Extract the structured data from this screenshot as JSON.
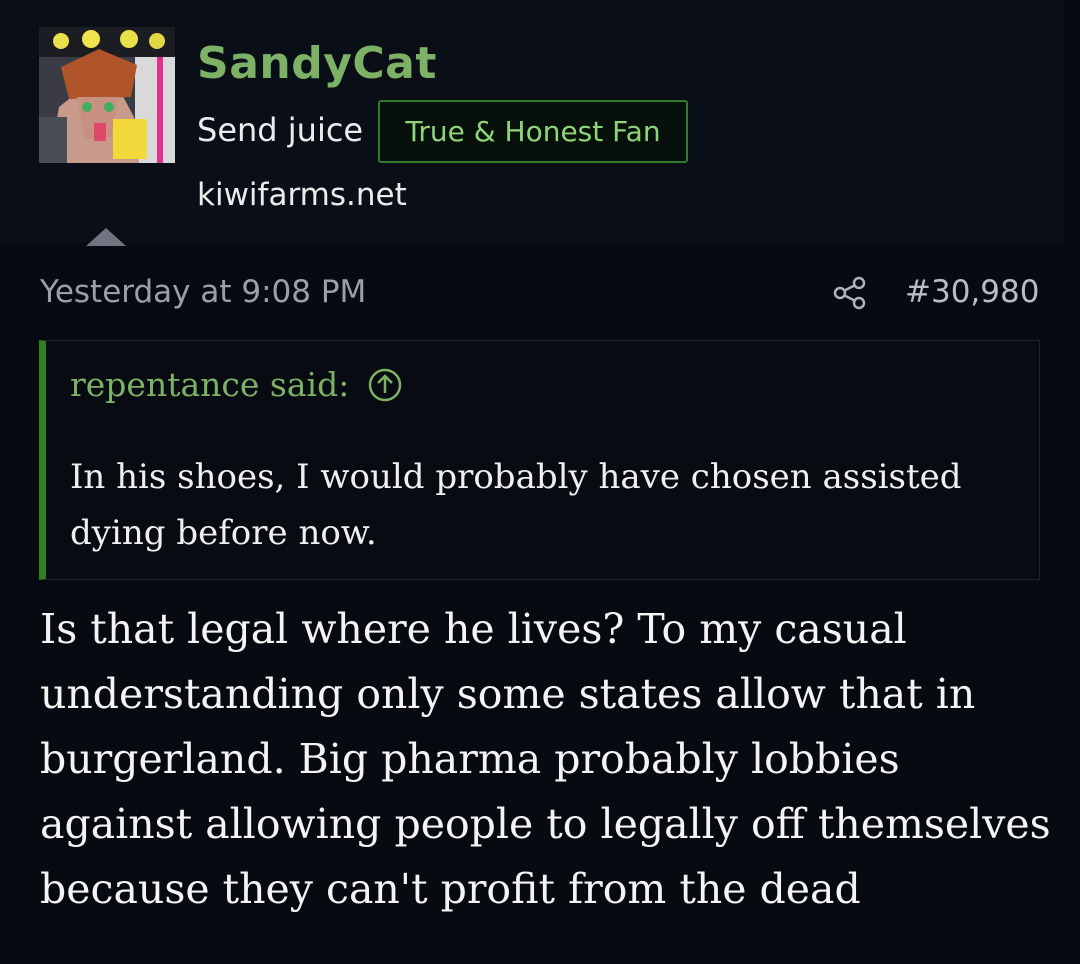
{
  "user": {
    "username": "SandyCat",
    "title": "Send juice",
    "badge": "True & Honest Fan",
    "site": "kiwifarms.net"
  },
  "post": {
    "date": "Yesterday at 9:08 PM",
    "number": "#30,980",
    "quote": {
      "author": "repentance said:",
      "text": "In his shoes, I would probably have chosen assisted dying before now."
    },
    "body": "Is that legal where he lives? To my casual understanding only some states allow that in burgerland. Big pharma probably lobbies against allowing people to legally off themselves because they can't profit from the dead"
  },
  "colors": {
    "background": "#070a10",
    "username": "#7db266",
    "badge_border": "#2f7a2b",
    "badge_text": "#8fd47a",
    "quote_bar": "#2f7f27"
  },
  "icons": {
    "share": "share-icon",
    "quote_jump": "arrow-circle-up-icon",
    "collapse": "triangle-up-icon"
  }
}
